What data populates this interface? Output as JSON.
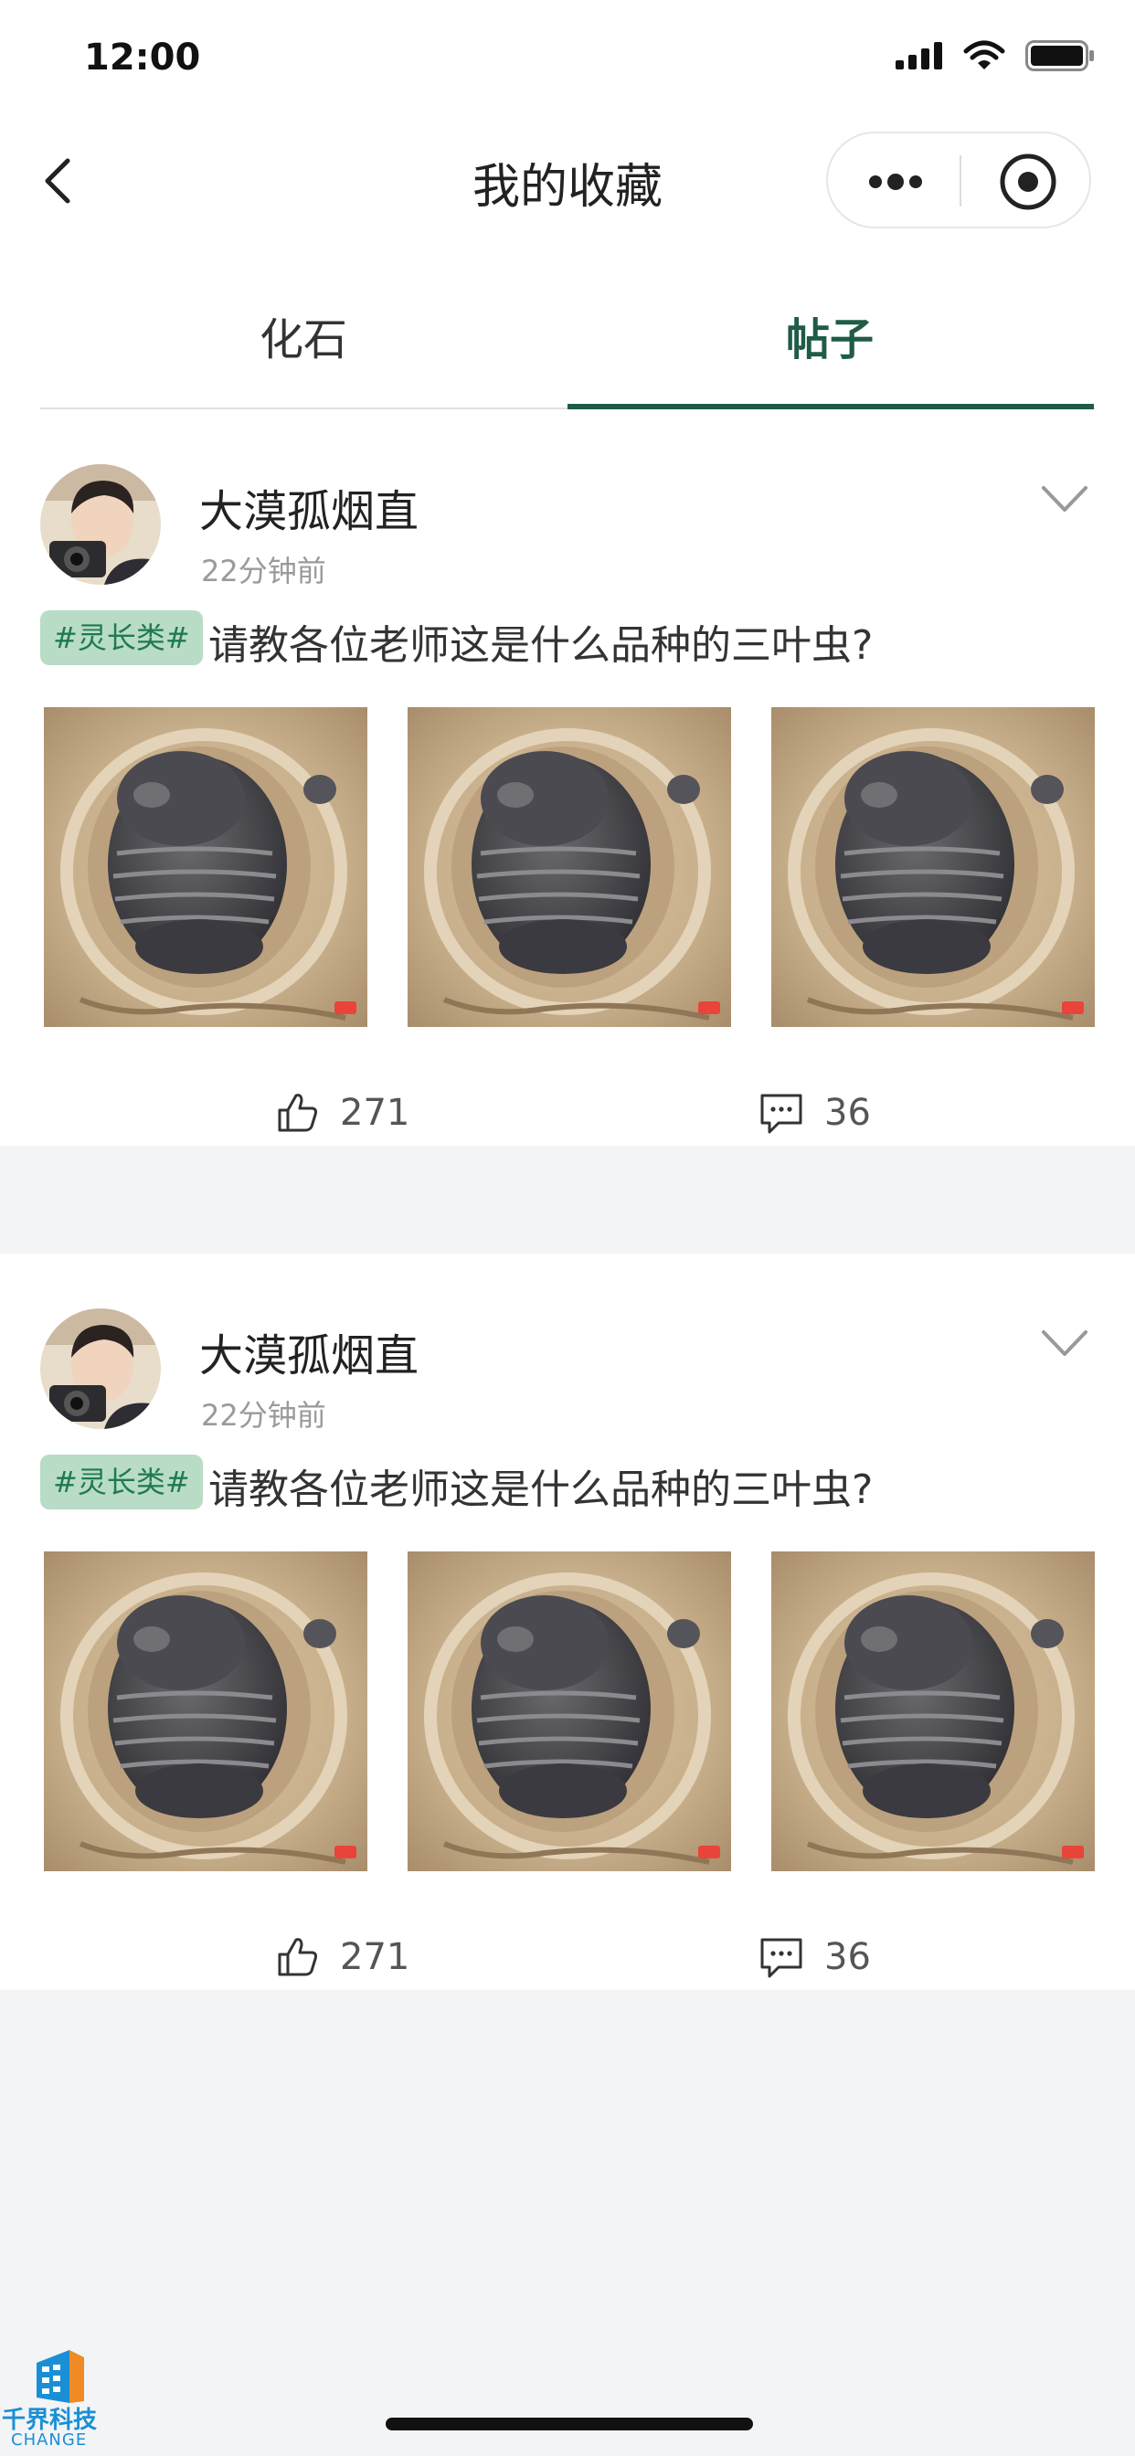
{
  "status_bar": {
    "time": "12:00"
  },
  "header": {
    "title": "我的收藏"
  },
  "tabs": [
    {
      "label": "化石",
      "active": false
    },
    {
      "label": "帖子",
      "active": true
    }
  ],
  "colors": {
    "accent": "#1f5c45",
    "tag_bg": "#b9dcc6",
    "tag_text": "#1f7a4f",
    "background": "#f3f4f6"
  },
  "posts": [
    {
      "author": "大漠孤烟直",
      "time": "22分钟前",
      "tag": "#灵长类#",
      "text": "请教各位老师这是什么品种的三叶虫?",
      "images": [
        "trilobite-fossil",
        "trilobite-fossil",
        "trilobite-fossil"
      ],
      "likes": "271",
      "comments": "36"
    },
    {
      "author": "大漠孤烟直",
      "time": "22分钟前",
      "tag": "#灵长类#",
      "text": "请教各位老师这是什么品种的三叶虫?",
      "images": [
        "trilobite-fossil",
        "trilobite-fossil",
        "trilobite-fossil"
      ],
      "likes": "271",
      "comments": "36"
    }
  ],
  "watermark": {
    "text": "千界科技",
    "sub": "CHANGE"
  }
}
